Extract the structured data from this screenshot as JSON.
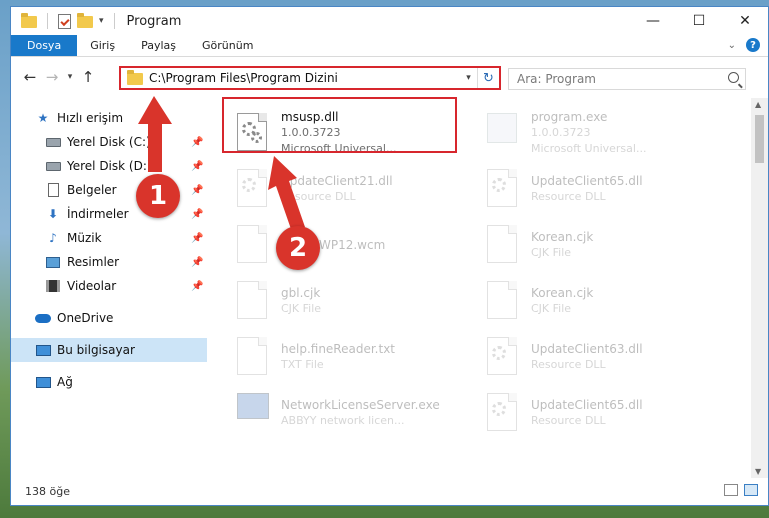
{
  "window": {
    "title": "Program",
    "controls": {
      "minimize": "—",
      "maximize": "☐",
      "close": "✕"
    }
  },
  "ribbon": {
    "tabs": [
      "Dosya",
      "Giriş",
      "Paylaş",
      "Görünüm"
    ],
    "help": "?"
  },
  "nav": {
    "address": "C:\\Program Files\\Program Dizini",
    "search_placeholder": "Ara: Program"
  },
  "sidebar": {
    "items": [
      {
        "label": "Hızlı erişim",
        "icon": "star-icon"
      },
      {
        "label": "Yerel Disk (C:)",
        "icon": "drive-icon"
      },
      {
        "label": "Yerel Disk (D:)",
        "icon": "drive-icon"
      },
      {
        "label": "Belgeler",
        "icon": "documents-icon"
      },
      {
        "label": "İndirmeler",
        "icon": "download-icon"
      },
      {
        "label": "Müzik",
        "icon": "music-icon"
      },
      {
        "label": "Resimler",
        "icon": "pictures-icon"
      },
      {
        "label": "Videolar",
        "icon": "videos-icon"
      },
      {
        "label": "OneDrive",
        "icon": "cloud-icon"
      },
      {
        "label": "Bu bilgisayar",
        "icon": "computer-icon"
      },
      {
        "label": "Ağ",
        "icon": "network-icon"
      }
    ]
  },
  "files": [
    {
      "name": "msusp.dll",
      "line2": "1.0.0.3723",
      "line3": "Microsoft Universal...",
      "icon": "dll-gear-icon"
    },
    {
      "name": "program.exe",
      "line2": "1.0.0.3723",
      "line3": "Microsoft Universal...",
      "icon": "exe-icon"
    },
    {
      "name": "UpdateClient21.dll",
      "line2": "Resource DLL",
      "icon": "dll-icon"
    },
    {
      "name": "UpdateClient65.dll",
      "line2": "Resource DLL",
      "icon": "dll-icon"
    },
    {
      "name": "WP12.wcm",
      "line2": "",
      "icon": "file-icon"
    },
    {
      "name": "Korean.cjk",
      "line2": "CJK File",
      "icon": "file-icon"
    },
    {
      "name": "gbl.cjk",
      "line2": "CJK File",
      "icon": "file-icon"
    },
    {
      "name": "Korean.cjk",
      "line2": "CJK File",
      "icon": "file-icon"
    },
    {
      "name": "help.fineReader.txt",
      "line2": "TXT File",
      "icon": "file-icon"
    },
    {
      "name": "UpdateClient63.dll",
      "line2": "Resource DLL",
      "icon": "dll-icon"
    },
    {
      "name": "NetworkLicenseServer.exe",
      "line2": "ABBYY network licen...",
      "icon": "app-icon"
    },
    {
      "name": "UpdateClient65.dll",
      "line2": "Resource DLL",
      "icon": "dll-icon"
    }
  ],
  "status": {
    "count": "138 öğe"
  },
  "callouts": {
    "one": "1",
    "two": "2"
  },
  "colors": {
    "accent": "#1979ca",
    "highlight": "#d7262d"
  }
}
